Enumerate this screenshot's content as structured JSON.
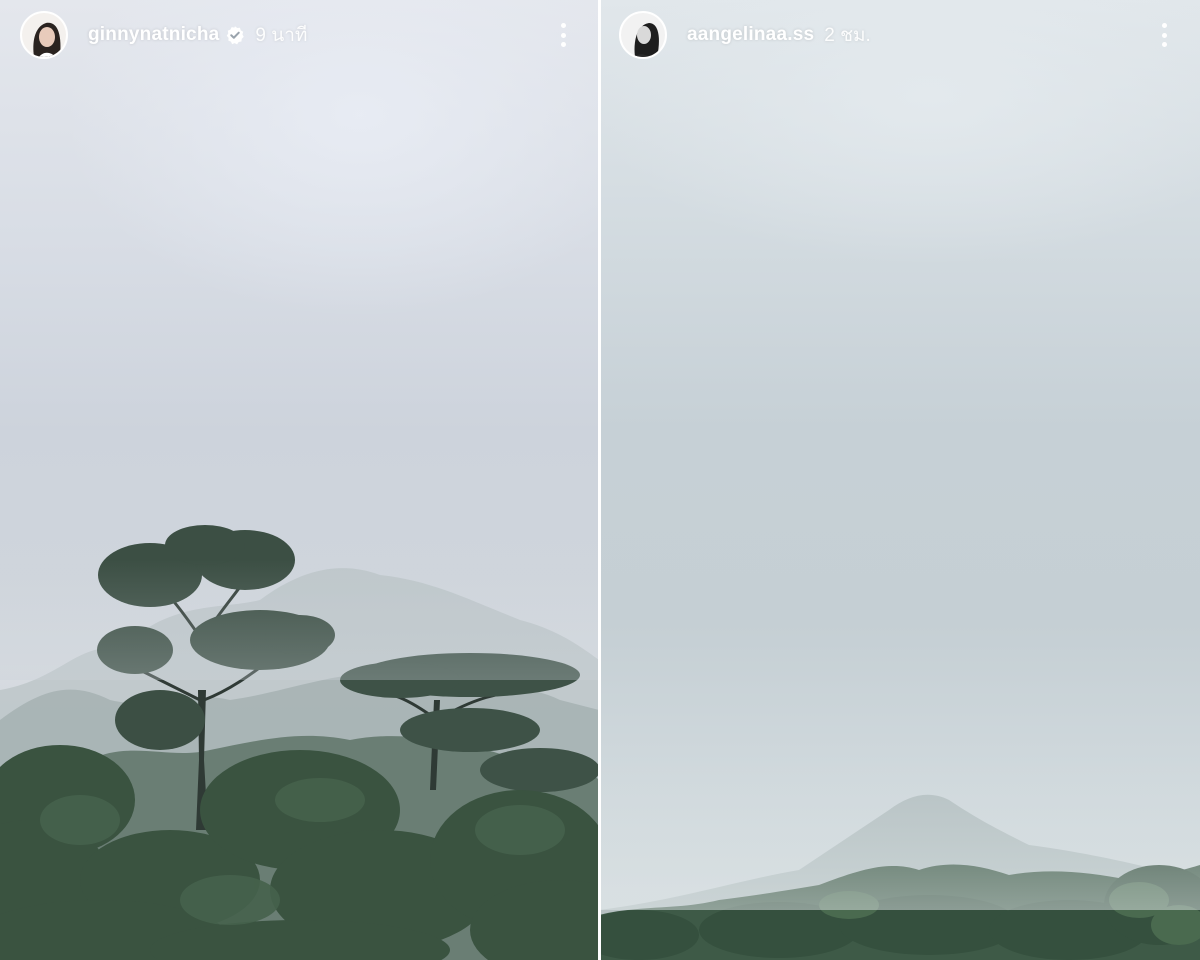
{
  "stories": [
    {
      "username": "ginnynatnicha",
      "verified": true,
      "time_ago": "9 นาที",
      "avatar_icon": "profile-photo",
      "more_icon": "more-vertical-icon"
    },
    {
      "username": "aangelinaa.ss",
      "verified": false,
      "time_ago": "2 ชม.",
      "avatar_icon": "profile-photo",
      "more_icon": "more-vertical-icon"
    }
  ],
  "colors": {
    "text": "#ffffff",
    "verified_badge": "#ffffff",
    "divider": "#ffffff"
  }
}
